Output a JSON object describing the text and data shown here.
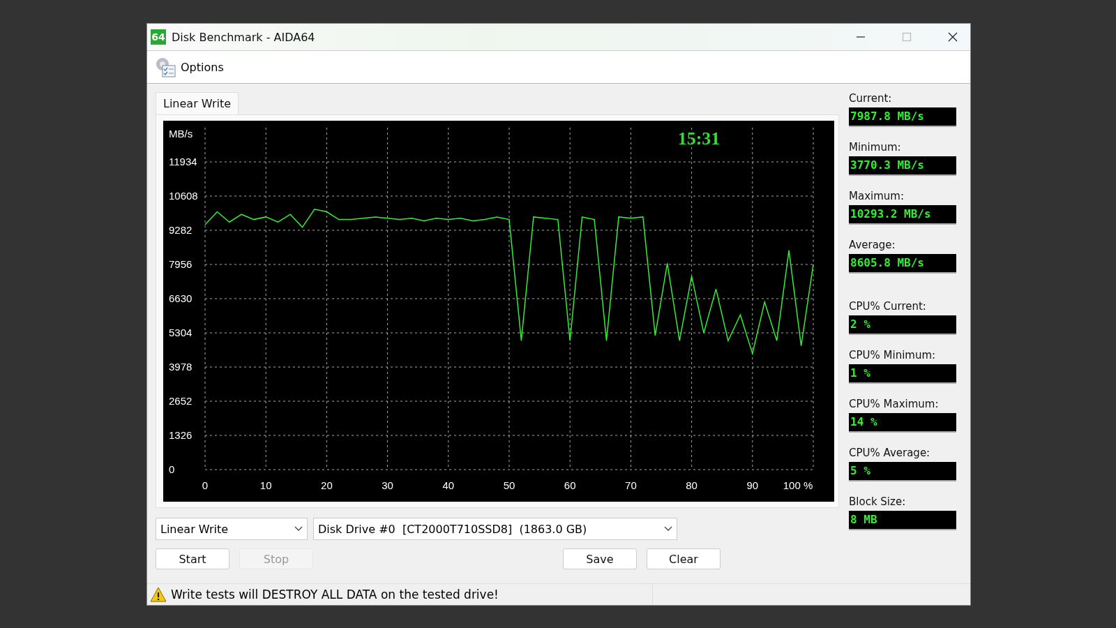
{
  "window": {
    "title": "Disk Benchmark - AIDA64",
    "logo_text": "64"
  },
  "menu": [
    {
      "label": "Options"
    }
  ],
  "tabs": [
    {
      "label": "Linear Write",
      "selected": true
    }
  ],
  "chart": {
    "clock": "15:31",
    "chart_data": {
      "type": "line",
      "grid": true,
      "ylabel": "MB/s",
      "xlim": [
        0,
        100
      ],
      "ylim": [
        0,
        13260
      ],
      "xticks": [
        0,
        10,
        20,
        30,
        40,
        50,
        60,
        70,
        80,
        90,
        {
          "value": 100,
          "label": "100 %"
        }
      ],
      "yticks": [
        0,
        1326,
        2652,
        3978,
        5304,
        6630,
        7956,
        9282,
        10608,
        11934
      ],
      "x": [
        0,
        2,
        4,
        6,
        8,
        10,
        12,
        14,
        16,
        18,
        20,
        22,
        24,
        26,
        28,
        30,
        32,
        34,
        36,
        38,
        40,
        42,
        44,
        46,
        48,
        50,
        52,
        54,
        56,
        58,
        60,
        62,
        64,
        66,
        68,
        70,
        72,
        74,
        76,
        78,
        80,
        82,
        84,
        86,
        88,
        90,
        92,
        94,
        96,
        98,
        100
      ],
      "series": [
        {
          "color": "#33ee33",
          "values": [
            9500,
            10000,
            9600,
            9900,
            9700,
            9800,
            9600,
            9900,
            9400,
            10100,
            10000,
            9700,
            9700,
            9750,
            9800,
            9750,
            9700,
            9750,
            9650,
            9750,
            9700,
            9750,
            9650,
            9700,
            9800,
            9700,
            5000,
            9800,
            9750,
            9700,
            5000,
            9800,
            9700,
            5000,
            9800,
            9750,
            9800,
            5200,
            8000,
            5000,
            7500,
            5300,
            7000,
            5000,
            6000,
            4500,
            6500,
            5000,
            8500,
            4800,
            7950
          ]
        }
      ]
    }
  },
  "stats": [
    {
      "label": "Current:",
      "value": "7987.8 MB/s"
    },
    {
      "label": "Minimum:",
      "value": "3770.3 MB/s"
    },
    {
      "label": "Maximum:",
      "value": "10293.2 MB/s"
    },
    {
      "label": "Average:",
      "value": "8605.8 MB/s"
    },
    {
      "label": "CPU% Current:",
      "value": "2 %"
    },
    {
      "label": "CPU% Minimum:",
      "value": "1 %"
    },
    {
      "label": "CPU% Maximum:",
      "value": "14 %"
    },
    {
      "label": "CPU% Average:",
      "value": "5 %"
    },
    {
      "label": "Block Size:",
      "value": "8 MB"
    }
  ],
  "test_select": {
    "value": "Linear Write"
  },
  "drive_select": {
    "value": "Disk Drive #0  [CT2000T710SSD8]  (1863.0 GB)"
  },
  "buttons_left": [
    {
      "label": "Start",
      "disabled": false
    },
    {
      "label": "Stop",
      "disabled": true
    }
  ],
  "buttons_right": [
    {
      "label": "Save",
      "disabled": false
    },
    {
      "label": "Clear",
      "disabled": false
    }
  ],
  "status_bar": {
    "message": "Write tests will DESTROY ALL DATA on the tested drive!"
  }
}
